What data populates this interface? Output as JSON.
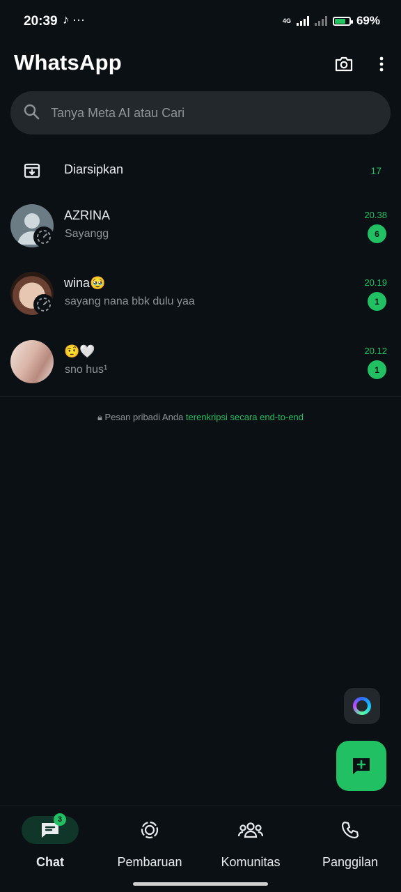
{
  "status_bar": {
    "time": "20:39",
    "network": "4G",
    "battery": "69%"
  },
  "header": {
    "title": "WhatsApp"
  },
  "search": {
    "placeholder": "Tanya Meta AI atau Cari"
  },
  "archived": {
    "label": "Diarsipkan",
    "count": "17"
  },
  "chats": [
    {
      "name": "AZRINA",
      "message": "Sayangg",
      "time": "20.38",
      "unread": "6"
    },
    {
      "name": "wina🥹",
      "message": "sayang nana bbk dulu yaa",
      "time": "20.19",
      "unread": "1"
    },
    {
      "name": "🤨🤍",
      "message": "sno hus¹",
      "time": "20.12",
      "unread": "1"
    }
  ],
  "encryption_notice": {
    "prefix": "Pesan pribadi Anda",
    "link": "terenkripsi secara end-to-end"
  },
  "bottom_nav": {
    "items": [
      {
        "label": "Chat",
        "badge": "3"
      },
      {
        "label": "Pembaruan"
      },
      {
        "label": "Komunitas"
      },
      {
        "label": "Panggilan"
      }
    ]
  },
  "colors": {
    "accent": "#21c063",
    "background": "#0b1014",
    "search_bg": "#23282c"
  }
}
